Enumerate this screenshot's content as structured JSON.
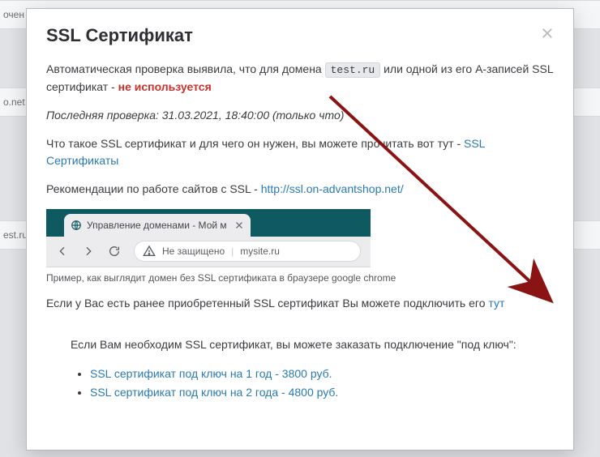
{
  "bg": {
    "row1": "очен",
    "row2": "o.net",
    "row3": "est.ru"
  },
  "modal": {
    "title": "SSL Сертификат",
    "auto_before": "Автоматическая проверка выявила, что для домена ",
    "domain": "test.ru",
    "auto_after": " или одной из его A-записей SSL сертификат - ",
    "not_used": "не используется",
    "last_check": "Последняя проверка: 31.03.2021, 18:40:00 (только что)",
    "whatis_before": "Что такое SSL сертификат и для чего он нужен, вы можете прочитать вот тут - ",
    "whatis_link": "SSL Сертификаты",
    "recom_before": "Рекомендации по работе сайтов с SSL - ",
    "recom_link": "http://ssl.on-advantshop.net/",
    "browser": {
      "tab_title": "Управление доменами - Мой м",
      "insecure": "Не защищено",
      "addr": "mysite.ru"
    },
    "caption": "Пример, как выглядит домен без SSL сертификата в браузере google chrome",
    "existing_before": "Если у Вас есть ранее приобретенный SSL сертификат Вы можете подключить его ",
    "existing_link": "тут",
    "order_intro": "Если Вам необходим SSL сертификат, вы можете заказать подключение \"под ключ\":",
    "plans": [
      "SSL сертификат под ключ на 1 год - 3800 руб.",
      "SSL сертификат под ключ на 2 года - 4800 руб."
    ]
  }
}
